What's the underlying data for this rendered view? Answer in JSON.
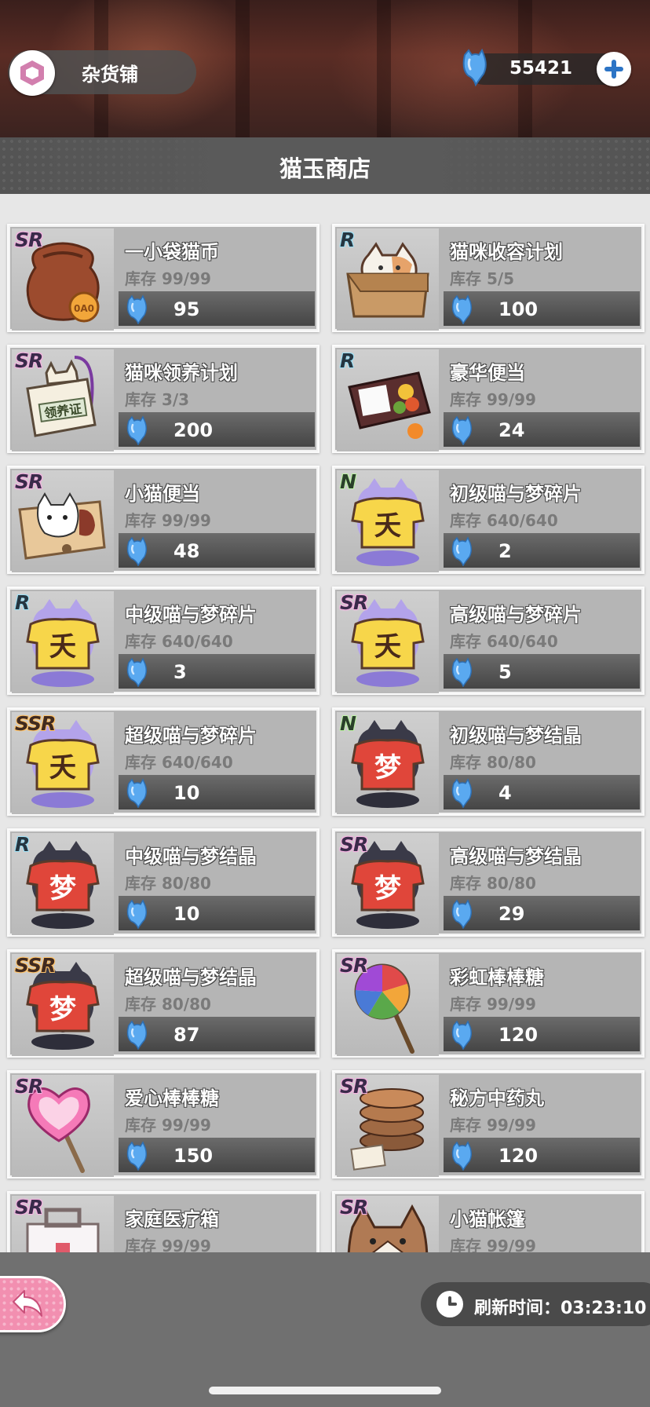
{
  "header": {
    "shop_label": "杂货铺",
    "currency_value": "55421",
    "page_title": "猫玉商店"
  },
  "colors": {
    "accent_pink": "#f28fb0",
    "currency_blue": "#5aa9f0",
    "price_bar": "#555555"
  },
  "items": [
    {
      "rarity": "SR",
      "name": "一小袋猫币",
      "stock": "库存 99/99",
      "price": "95",
      "icon": "coin-bag-icon"
    },
    {
      "rarity": "R",
      "name": "猫咪收容计划",
      "stock": "库存 5/5",
      "price": "100",
      "icon": "cat-in-box-icon"
    },
    {
      "rarity": "SR",
      "name": "猫咪领养计划",
      "stock": "库存 3/3",
      "price": "200",
      "icon": "adoption-card-icon",
      "card_text": "领养证"
    },
    {
      "rarity": "R",
      "name": "豪华便当",
      "stock": "库存 99/99",
      "price": "24",
      "icon": "deluxe-bento-icon"
    },
    {
      "rarity": "SR",
      "name": "小猫便当",
      "stock": "库存 99/99",
      "price": "48",
      "icon": "kitten-bento-icon"
    },
    {
      "rarity": "N",
      "name": "初级喵与梦碎片",
      "stock": "库存 640/640",
      "price": "2",
      "icon": "yellow-cat-shirt-icon",
      "glyph": "夭"
    },
    {
      "rarity": "R",
      "name": "中级喵与梦碎片",
      "stock": "库存 640/640",
      "price": "3",
      "icon": "yellow-cat-shirt-icon",
      "glyph": "夭"
    },
    {
      "rarity": "SR",
      "name": "高级喵与梦碎片",
      "stock": "库存 640/640",
      "price": "5",
      "icon": "yellow-cat-shirt-icon",
      "glyph": "夭"
    },
    {
      "rarity": "SSR",
      "name": "超级喵与梦碎片",
      "stock": "库存 640/640",
      "price": "10",
      "icon": "yellow-cat-shirt-icon",
      "glyph": "夭"
    },
    {
      "rarity": "N",
      "name": "初级喵与梦结晶",
      "stock": "库存 80/80",
      "price": "4",
      "icon": "red-cat-shirt-icon",
      "glyph": "梦"
    },
    {
      "rarity": "R",
      "name": "中级喵与梦结晶",
      "stock": "库存 80/80",
      "price": "10",
      "icon": "red-cat-shirt-icon",
      "glyph": "梦"
    },
    {
      "rarity": "SR",
      "name": "高级喵与梦结晶",
      "stock": "库存 80/80",
      "price": "29",
      "icon": "red-cat-shirt-icon",
      "glyph": "梦"
    },
    {
      "rarity": "SSR",
      "name": "超级喵与梦结晶",
      "stock": "库存 80/80",
      "price": "87",
      "icon": "red-cat-shirt-icon",
      "glyph": "梦"
    },
    {
      "rarity": "SR",
      "name": "彩虹棒棒糖",
      "stock": "库存 99/99",
      "price": "120",
      "icon": "rainbow-lollipop-icon"
    },
    {
      "rarity": "SR",
      "name": "爱心棒棒糖",
      "stock": "库存 99/99",
      "price": "150",
      "icon": "heart-lollipop-icon"
    },
    {
      "rarity": "SR",
      "name": "秘方中药丸",
      "stock": "库存 99/99",
      "price": "120",
      "icon": "herbal-pills-icon"
    },
    {
      "rarity": "SR",
      "name": "家庭医疗箱",
      "stock": "库存 99/99",
      "price": "",
      "icon": "medical-kit-icon"
    },
    {
      "rarity": "SR",
      "name": "小猫帐篷",
      "stock": "库存 99/99",
      "price": "",
      "icon": "cat-tent-icon"
    }
  ],
  "footer": {
    "refresh_label": "刷新时间：03:23:10"
  }
}
